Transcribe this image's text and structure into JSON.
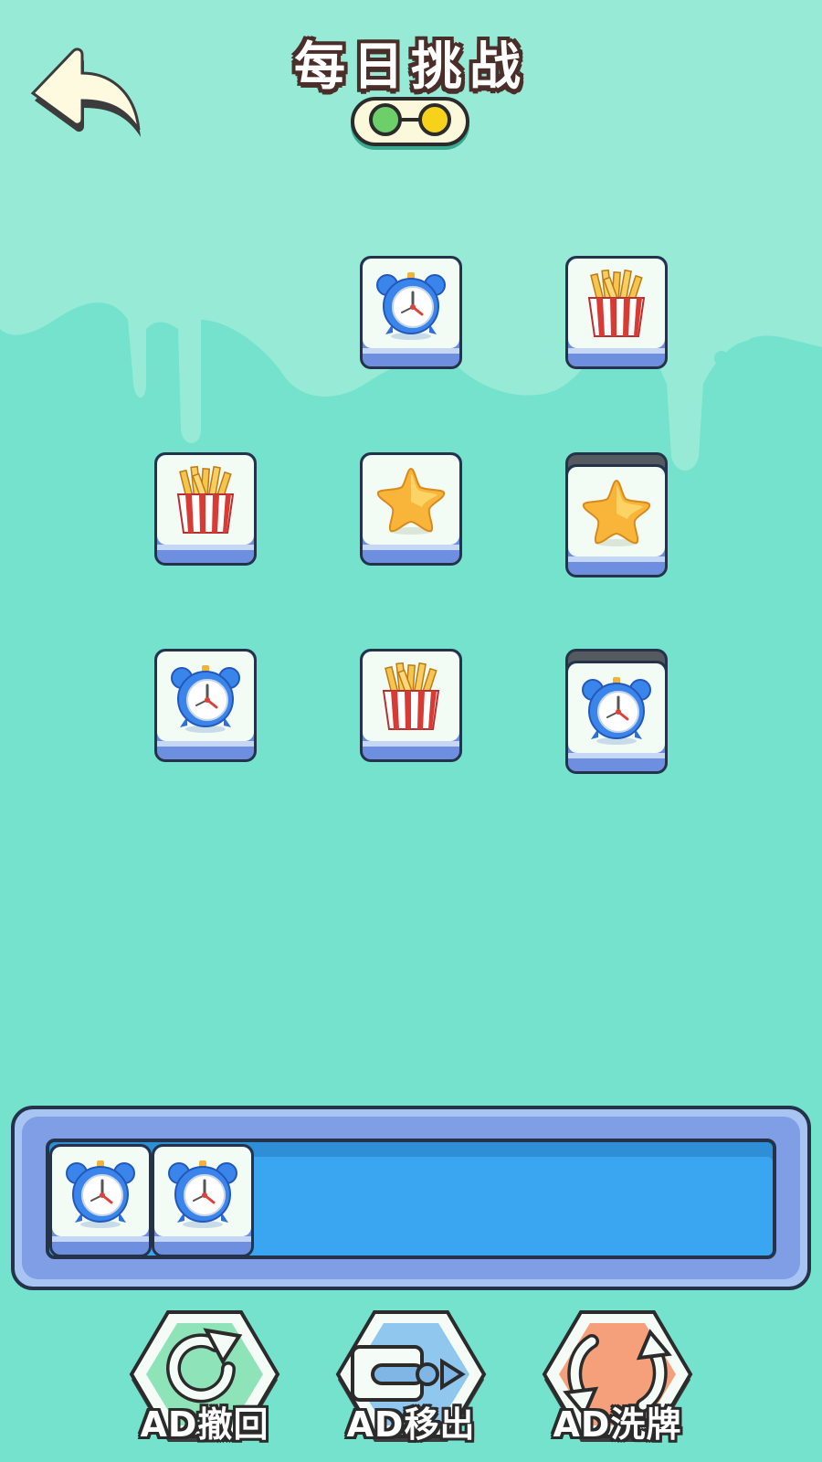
{
  "header": {
    "title": "每日挑战",
    "stage_progress": {
      "stages": 2,
      "colors": [
        "#6dcf6a",
        "#f7d21a"
      ]
    }
  },
  "board": {
    "tiles": [
      {
        "item": "alarm-clock",
        "covered": false
      },
      {
        "item": "french-fries",
        "covered": false
      },
      {
        "item": "french-fries",
        "covered": false
      },
      {
        "item": "star",
        "covered": false
      },
      {
        "item": "star",
        "covered": true
      },
      {
        "item": "alarm-clock",
        "covered": false
      },
      {
        "item": "french-fries",
        "covered": false
      },
      {
        "item": "alarm-clock",
        "covered": true
      }
    ]
  },
  "tray": {
    "capacity_slots": 7,
    "items": [
      "alarm-clock",
      "alarm-clock"
    ]
  },
  "tools": [
    {
      "label": "AD撤回",
      "icon": "undo-icon",
      "color": "#8fe3b8"
    },
    {
      "label": "AD移出",
      "icon": "move-out-icon",
      "color": "#8fc7ef"
    },
    {
      "label": "AD洗牌",
      "icon": "shuffle-icon",
      "color": "#f5a07a"
    }
  ],
  "colors": {
    "background": "#74e2cc",
    "tile_face": "#f3fbf5",
    "tile_base": "#6e8fe0",
    "tray": "#3aa6f2"
  }
}
